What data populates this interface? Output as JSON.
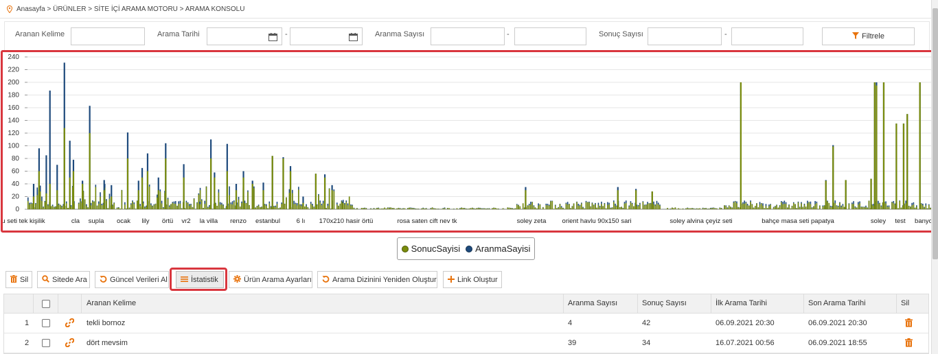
{
  "breadcrumb": {
    "icon": "location-pin-icon",
    "text": "Anasayfa > ÜRÜNLER > SİTE İÇİ ARAMA MOTORU > ARAMA KONSOLU"
  },
  "filters": {
    "keyword_label": "Aranan Kelime",
    "keyword_value": "",
    "date_label": "Arama Tarihi",
    "date_from": "",
    "date_to": "",
    "search_count_label": "Aranma Sayısı",
    "search_count_from": "",
    "search_count_to": "",
    "result_count_label": "Sonuç Sayısı",
    "result_count_from": "",
    "result_count_to": "",
    "separator": "-",
    "filter_button": "Filtrele",
    "filter_icon": "funnel-icon",
    "calendar_icon": "calendar-icon"
  },
  "colors": {
    "accent": "#e8730d",
    "highlight": "#d9363e",
    "sonuc": "#7a8c0c",
    "aranma": "#1e4a7c"
  },
  "chart_data": {
    "type": "bar",
    "y_ticks": [
      "0",
      "20",
      "40",
      "60",
      "80",
      "100",
      "120",
      "140",
      "160",
      "180",
      "200",
      "220",
      "240"
    ],
    "ylim": [
      0,
      240
    ],
    "grid": true,
    "x_labels": [
      "u seti tek kişilik",
      "cla",
      "supla",
      "ocak",
      "lily",
      "örtü",
      "vr2",
      "la villa",
      "renzo",
      "estanbul",
      "6 lı",
      "170x210 hasir örtü",
      "rosa saten cift nev tk",
      "soley zeta",
      "orient havlu 90x150",
      "sari",
      "soley alvina çeyiz seti",
      "bahçe masa seti papatya",
      "soley",
      "test",
      "banyo"
    ],
    "series": [
      {
        "name": "SonucSayisi",
        "color": "#7a8c0c"
      },
      {
        "name": "AranmaSayisi",
        "color": "#1e4a7c"
      }
    ],
    "peaks": [
      {
        "x": 0.3,
        "sonuc": 20,
        "aranma": 40
      },
      {
        "x": 0.6,
        "sonuc": 60,
        "aranma": 96
      },
      {
        "x": 1.0,
        "sonuc": 25,
        "aranma": 85
      },
      {
        "x": 1.2,
        "sonuc": 40,
        "aranma": 187
      },
      {
        "x": 1.6,
        "sonuc": 30,
        "aranma": 70
      },
      {
        "x": 2.0,
        "sonuc": 128,
        "aranma": 231
      },
      {
        "x": 2.3,
        "sonuc": 50,
        "aranma": 108
      },
      {
        "x": 2.5,
        "sonuc": 60,
        "aranma": 78
      },
      {
        "x": 3.0,
        "sonuc": 40,
        "aranma": 45
      },
      {
        "x": 3.4,
        "sonuc": 120,
        "aranma": 163
      },
      {
        "x": 4.2,
        "sonuc": 30,
        "aranma": 46
      },
      {
        "x": 4.6,
        "sonuc": 20,
        "aranma": 38
      },
      {
        "x": 5.5,
        "sonuc": 80,
        "aranma": 121
      },
      {
        "x": 6.1,
        "sonuc": 30,
        "aranma": 45
      },
      {
        "x": 6.3,
        "sonuc": 50,
        "aranma": 65
      },
      {
        "x": 6.6,
        "sonuc": 60,
        "aranma": 88
      },
      {
        "x": 7.2,
        "sonuc": 30,
        "aranma": 50
      },
      {
        "x": 7.6,
        "sonuc": 80,
        "aranma": 104
      },
      {
        "x": 8.6,
        "sonuc": 50,
        "aranma": 71
      },
      {
        "x": 9.5,
        "sonuc": 8,
        "aranma": 12
      },
      {
        "x": 10.1,
        "sonuc": 80,
        "aranma": 110
      },
      {
        "x": 10.3,
        "sonuc": 50,
        "aranma": 58
      },
      {
        "x": 11.0,
        "sonuc": 60,
        "aranma": 103
      },
      {
        "x": 11.5,
        "sonuc": 30,
        "aranma": 40
      },
      {
        "x": 11.9,
        "sonuc": 50,
        "aranma": 60
      },
      {
        "x": 12.4,
        "sonuc": 40,
        "aranma": 45
      },
      {
        "x": 13.0,
        "sonuc": 30,
        "aranma": 42
      },
      {
        "x": 13.5,
        "sonuc": 84,
        "aranma": 84
      },
      {
        "x": 14.1,
        "sonuc": 80,
        "aranma": 82
      },
      {
        "x": 14.5,
        "sonuc": 60,
        "aranma": 68
      },
      {
        "x": 15.2,
        "sonuc": 10,
        "aranma": 20
      },
      {
        "x": 15.9,
        "sonuc": 56,
        "aranma": 56
      },
      {
        "x": 16.4,
        "sonuc": 50,
        "aranma": 55
      },
      {
        "x": 16.8,
        "sonuc": 30,
        "aranma": 38
      },
      {
        "x": 17.4,
        "sonuc": 10,
        "aranma": 12
      },
      {
        "x": 27.5,
        "sonuc": 30,
        "aranma": 35
      },
      {
        "x": 32.6,
        "sonuc": 30,
        "aranma": 35
      },
      {
        "x": 33.6,
        "sonuc": 30,
        "aranma": 32
      },
      {
        "x": 34.5,
        "sonuc": 28,
        "aranma": 28
      },
      {
        "x": 39.4,
        "sonuc": 200,
        "aranma": 200
      },
      {
        "x": 44.1,
        "sonuc": 45,
        "aranma": 46
      },
      {
        "x": 44.5,
        "sonuc": 99,
        "aranma": 101
      },
      {
        "x": 45.2,
        "sonuc": 46,
        "aranma": 46
      },
      {
        "x": 46.6,
        "sonuc": 48,
        "aranma": 48
      },
      {
        "x": 46.8,
        "sonuc": 200,
        "aranma": 200
      },
      {
        "x": 46.9,
        "sonuc": 195,
        "aranma": 200
      },
      {
        "x": 47.3,
        "sonuc": 200,
        "aranma": 200
      },
      {
        "x": 48.0,
        "sonuc": 135,
        "aranma": 135
      },
      {
        "x": 48.4,
        "sonuc": 135,
        "aranma": 135
      },
      {
        "x": 48.6,
        "sonuc": 150,
        "aranma": 150
      },
      {
        "x": 49.3,
        "sonuc": 200,
        "aranma": 200
      }
    ]
  },
  "legend": {
    "sonuc_label": "SonucSayisi",
    "aranma_label": "AranmaSayisi"
  },
  "toolbar": {
    "delete": "Sil",
    "site_search": "Sitede Ara",
    "refresh": "Güncel Verileri Al",
    "stats": "İstatistik",
    "settings": "Ürün Arama Ayarları",
    "rebuild_index": "Arama Dizinini Yeniden Oluştur",
    "create_link": "Link Oluştur"
  },
  "table": {
    "headers": {
      "keyword": "Aranan Kelime",
      "search_count": "Aranma Sayısı",
      "result_count": "Sonuç Sayısı",
      "first_date": "İlk Arama Tarihi",
      "last_date": "Son Arama Tarihi",
      "delete": "Sil"
    },
    "rows": [
      {
        "index": "1",
        "keyword": "tekli bornoz",
        "search_count": "4",
        "result_count": "42",
        "first_date": "06.09.2021 20:30",
        "last_date": "06.09.2021 20:30"
      },
      {
        "index": "2",
        "keyword": "dört mevsim",
        "search_count": "39",
        "result_count": "34",
        "first_date": "16.07.2021 00:56",
        "last_date": "06.09.2021 18:55"
      }
    ]
  }
}
